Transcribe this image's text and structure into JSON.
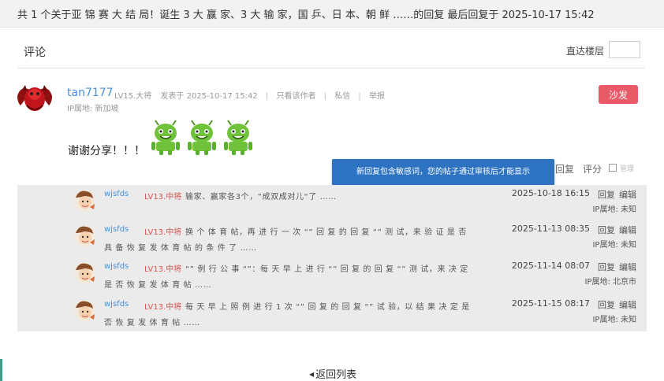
{
  "topbar": {
    "title": "共 1 个关于亚 锦 赛 大 结 局！诞生 3 大 赢 家、3 大 输 家，国 乒、日 本、朝 鲜 ……的回复 最后回复于 2025-10-17 15:42"
  },
  "comment_header": {
    "label": "评论",
    "jump_label": "直达楼层",
    "jump_value": ""
  },
  "post": {
    "username": "tan7177",
    "level": "LV15.大将",
    "posted_at": "发表于 2025-10-17 15:42",
    "view_author": "只看该作者",
    "private_msg": "私信",
    "report": "举报",
    "ip": "IP属地: 新加坡",
    "sofa": "沙发",
    "content": "谢谢分享！！！",
    "emoji": "android-emoji"
  },
  "toast": "新回复包含敏感词，您的帖子通过审核后才能显示",
  "actions": {
    "reply": "回复",
    "rate": "评分",
    "manage": "管理"
  },
  "replies": [
    {
      "user": "wjsfds",
      "level": "LV13.中将",
      "text": "输家、赢家各3个，“成双成对儿“了 ……",
      "date": "2025-10-18 16:15",
      "reply": "回复",
      "edit": "编辑",
      "ip": "IP属地: 未知"
    },
    {
      "user": "wjsfds",
      "level": "LV13.中将",
      "text": "换 个 体 育 帖，再 进 行 一 次 “” 回 复 的 回 复 “” 测 试，来 验 证 是 否 具 备 恢 复 发 体 育 帖 的 条 件 了 ……",
      "date": "2025-11-13 08:35",
      "reply": "回复",
      "edit": "编辑",
      "ip": "IP属地: 未知"
    },
    {
      "user": "wjsfds",
      "level": "LV13.中将",
      "text": "“” 例 行 公 事 “”：每 天 早 上 进 行 “” 回 复 的 回 复 “” 测 试，来 决 定 是 否 恢 复 发 体 育 帖 ……",
      "date": "2025-11-14 08:07",
      "reply": "回复",
      "edit": "编辑",
      "ip": "IP属地: 北京市"
    },
    {
      "user": "wjsfds",
      "level": "LV13.中将",
      "text": "每 天 早 上 照 例 进 行 1 次 “” 回 复 的 回 复 “” 试 验，以 结 果 决 定 是 否 恢 复 发 体 育 帖 ……",
      "date": "2025-11-15 08:17",
      "reply": "回复",
      "edit": "编辑",
      "ip": "IP属地: 未知"
    }
  ],
  "back_label": "返回列表",
  "colors": {
    "link_blue": "#4a90d9",
    "level_red": "#d9534f",
    "sofa_red": "#e85a68",
    "toast_blue": "#2d73c2",
    "reply_bg": "#ebebeb"
  }
}
